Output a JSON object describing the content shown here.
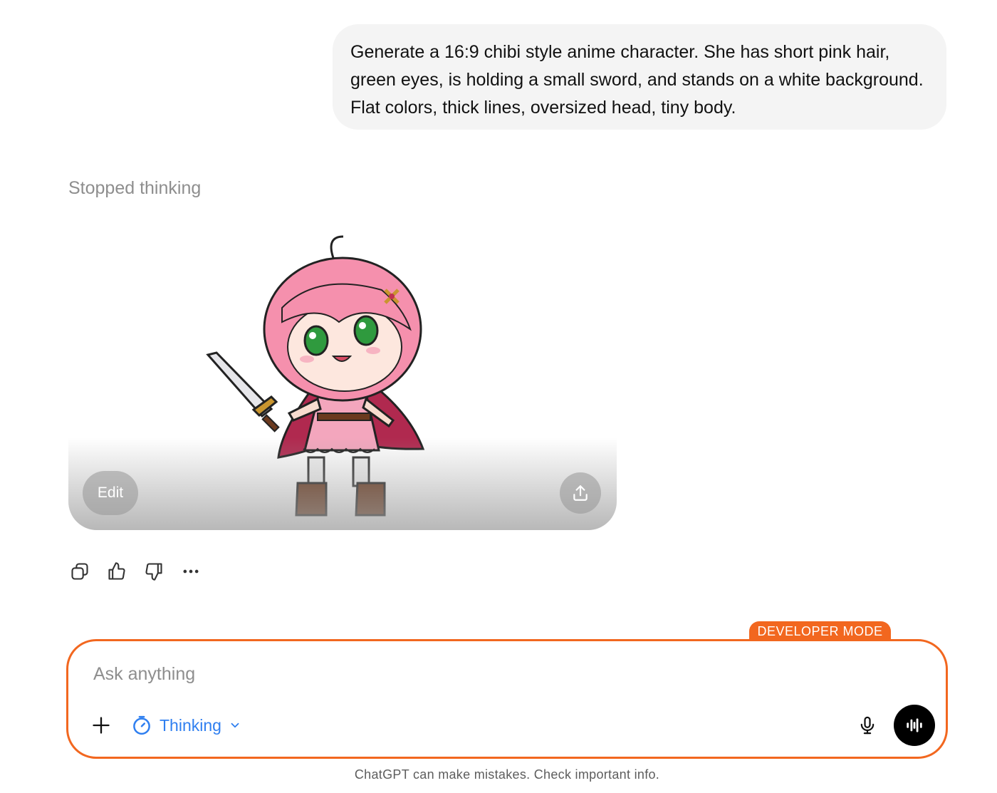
{
  "conversation": {
    "user_message": "Generate a 16:9 chibi style anime character. She has short pink hair, green eyes, is holding a small sword, and stands on a white background. Flat colors, thick lines, oversized head, tiny body.",
    "status": "Stopped thinking"
  },
  "image_card": {
    "edit_label": "Edit",
    "share_icon": "share-upload-icon"
  },
  "actions": {
    "copy_icon": "copy-icon",
    "like_icon": "thumbs-up-icon",
    "dislike_icon": "thumbs-down-icon",
    "more_icon": "more-icon"
  },
  "composer": {
    "badge": "DEVELOPER MODE",
    "placeholder": "Ask anything",
    "mode_label": "Thinking",
    "accent_color": "#f2671f",
    "mode_color": "#2f7ff0"
  },
  "footer": {
    "disclaimer": "ChatGPT can make mistakes. Check important info."
  }
}
